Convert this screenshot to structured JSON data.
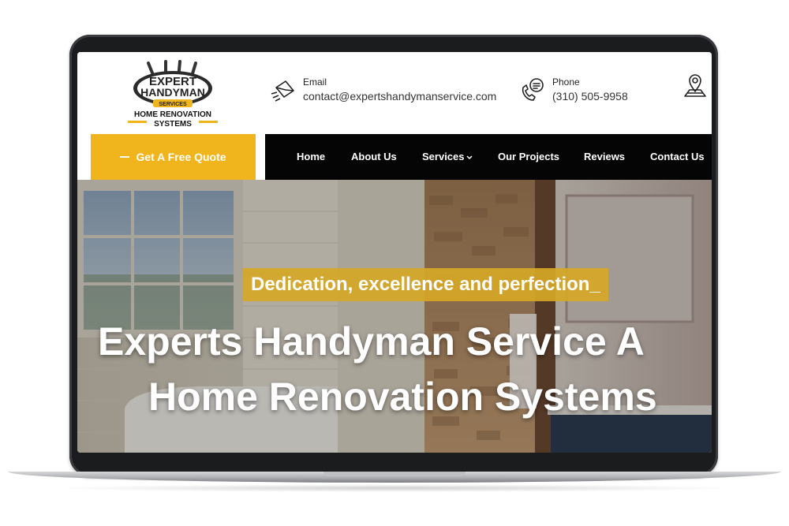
{
  "logo": {
    "line1": "EXPERT",
    "line2": "HANDYMAN",
    "line3": "SERVICES",
    "line4": "HOME RENOVATION",
    "line5": "SYSTEMS"
  },
  "contact": {
    "email_label": "Email",
    "email_value": "contact@expertshandymanservice.com",
    "phone_label": "Phone",
    "phone_value": "(310) 505-9958"
  },
  "cta": {
    "quote_label": "Get A Free Quote"
  },
  "nav": {
    "items": [
      {
        "label": "Home"
      },
      {
        "label": "About Us"
      },
      {
        "label": "Services"
      },
      {
        "label": "Our Projects"
      },
      {
        "label": "Reviews"
      },
      {
        "label": "Contact Us"
      }
    ]
  },
  "hero": {
    "tagline": "Dedication, excellence and perfection_",
    "title_line1": "Experts Handyman Service A",
    "title_line2": "Home Renovation Systems"
  },
  "colors": {
    "accent": "#f0b51c",
    "nav_bg": "#050505",
    "frame": "#1b1c1e"
  },
  "icons": [
    "envelope-icon",
    "phone-chat-icon",
    "map-pin-icon",
    "chevron-down-icon",
    "wrench-logo-icon"
  ]
}
